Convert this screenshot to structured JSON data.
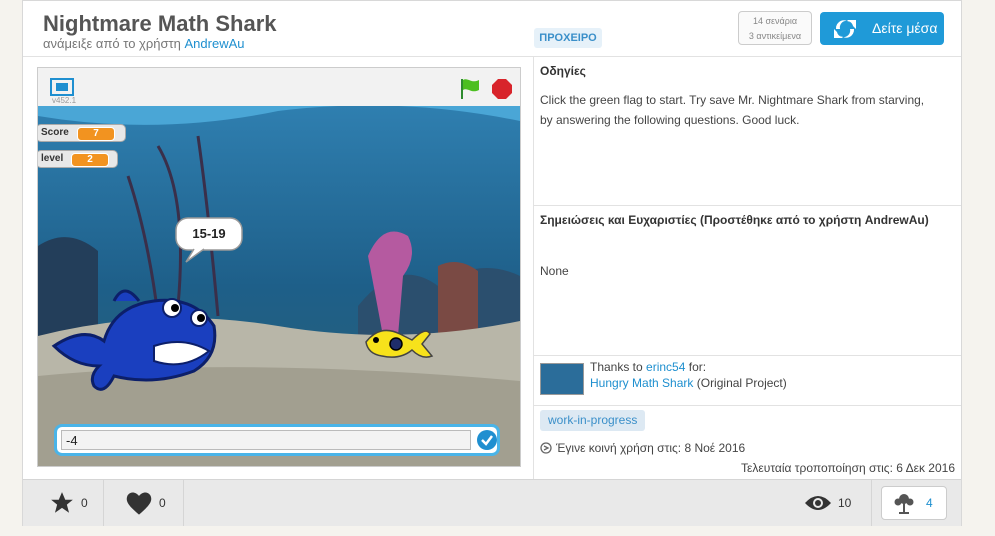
{
  "project": {
    "title": "Nightmare Math Shark",
    "remix_prefix": "ανάμειξε από το χρήστη",
    "author": "AndrewAu",
    "draft_label": "ΠΡΟΧΕΙΡΟ",
    "scripts_count": "14 σενάρια",
    "sprites_count": "3 αντικείμενα",
    "see_inside_label": "Δείτε μέσα"
  },
  "player": {
    "version": "v452.1",
    "monitors": [
      {
        "label": "Score",
        "value": "7"
      },
      {
        "label": "level",
        "value": "2"
      }
    ],
    "speech": "15-19",
    "ask_answer": "-4"
  },
  "instructions": {
    "heading": "Οδηγίες",
    "text": "Click the green flag to start. Try save Mr. Nightmare Shark from starving, by answering the following questions. Good luck."
  },
  "notes": {
    "heading": "Σημειώσεις και Ευχαριστίες (Προστέθηκε από το χρήστη AndrewAu)",
    "text": "None"
  },
  "credits": {
    "thanks_prefix": "Thanks to",
    "thanks_user": "erinc54",
    "thanks_suffix": "for:",
    "original_link": "Hungry Math Shark",
    "original_suffix": "(Original Project)"
  },
  "tags": [
    "work-in-progress"
  ],
  "dates": {
    "shared": "Έγινε κοινή χρήση στις: 8 Νοέ 2016",
    "modified": "Τελευταία τροποποίηση στις: 6 Δεκ 2016"
  },
  "stats": {
    "favorites": "0",
    "loves": "0",
    "views": "10",
    "remixes": "4"
  },
  "colors": {
    "accent": "#1f9ad8",
    "monitor_value": "#f29320",
    "shark": "#1a3fbf",
    "fish": "#f7e21b"
  }
}
